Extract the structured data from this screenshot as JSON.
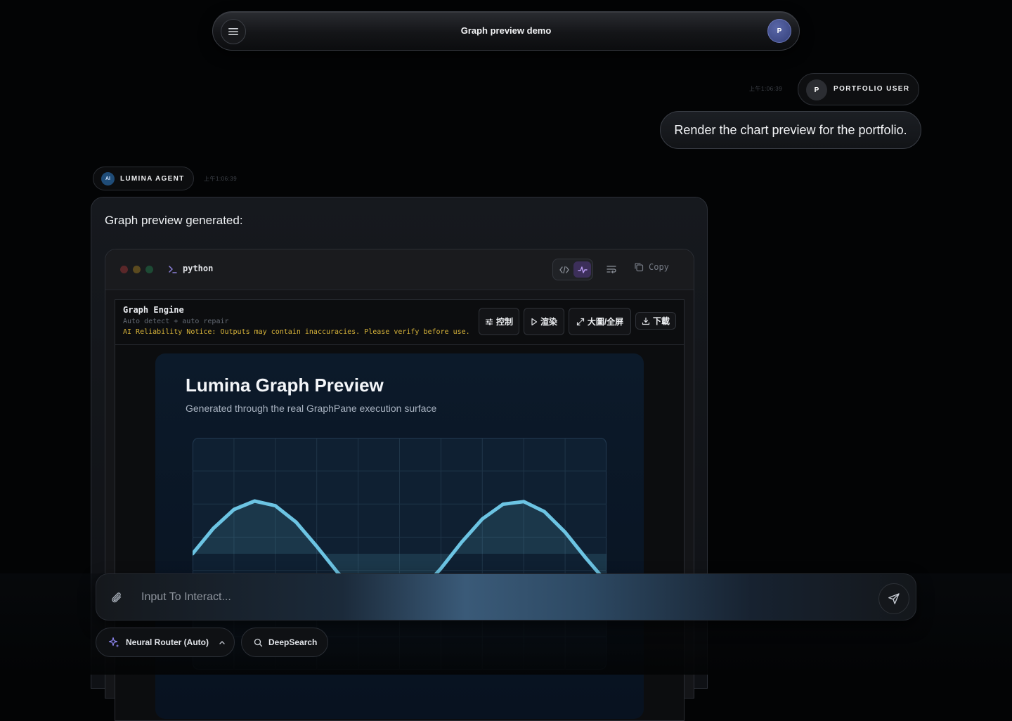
{
  "topbar": {
    "title": "Graph preview demo",
    "avatar_initial": "P"
  },
  "user_message": {
    "time": "上午1:06:39",
    "avatar_initial": "P",
    "sender": "PORTFOLIO USER",
    "text": "Render the chart preview for the portfolio."
  },
  "agent_message": {
    "avatar_label": "AI",
    "sender": "LUMINA AGENT",
    "time": "上午1:06:39",
    "intro": "Graph preview generated:"
  },
  "code_block": {
    "language": "python",
    "copy_label": "Copy",
    "engine": {
      "title": "Graph Engine",
      "subtitle": "Auto detect + auto repair",
      "notice": "AI Reliability Notice: Outputs may contain inaccuracies. Please verify before use.",
      "controls_label": "控制",
      "render_label": "渲染",
      "fullscreen_label": "大圖/全屏",
      "download_label": "下載"
    }
  },
  "preview": {
    "title": "Lumina Graph Preview",
    "subtitle": "Generated through the real GraphPane execution surface"
  },
  "chart_data": {
    "type": "area",
    "title": "Lumina Graph Preview",
    "subtitle": "Generated through the real GraphPane execution surface",
    "x": [
      0,
      0.5,
      1,
      1.5,
      2,
      2.5,
      3,
      3.5,
      4,
      4.5,
      5,
      5.5,
      6,
      6.5,
      7,
      7.5,
      8,
      8.5,
      9,
      9.5,
      10
    ],
    "y": [
      0,
      0.48,
      0.84,
      1.0,
      0.91,
      0.6,
      0.14,
      -0.35,
      -0.76,
      -0.98,
      -0.96,
      -0.71,
      -0.28,
      0.22,
      0.66,
      0.94,
      0.99,
      0.8,
      0.41,
      -0.08,
      -0.54
    ],
    "xlim": [
      0,
      10
    ],
    "ylim": [
      -2.2,
      2.2
    ],
    "grid": true,
    "line_color": "#6cc4e3"
  },
  "composer": {
    "placeholder": "Input To Interact...",
    "model_label": "Neural Router (Auto)",
    "deepsearch_label": "DeepSearch"
  }
}
